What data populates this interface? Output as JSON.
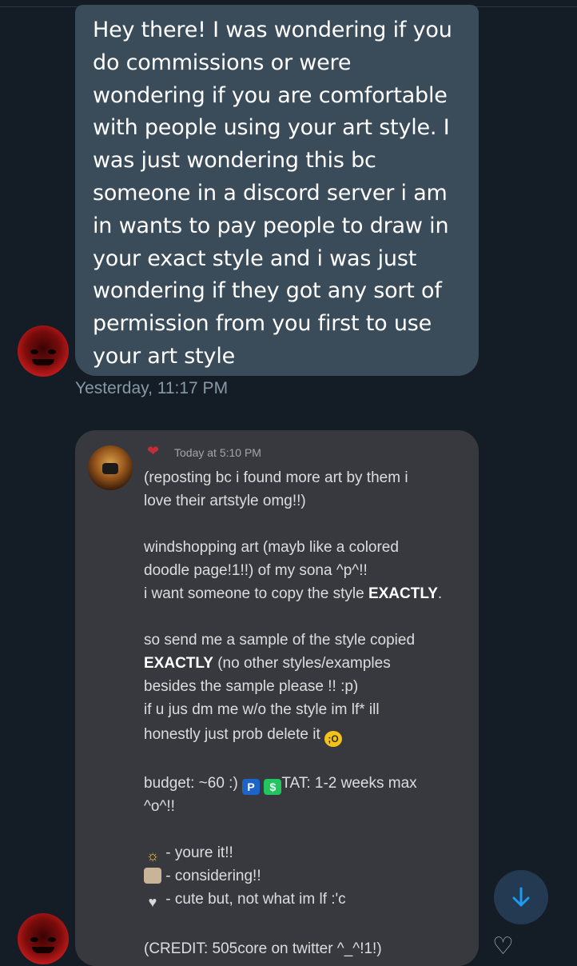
{
  "messages": {
    "received_text": "Hey there! I was wondering if you do commissions or were wondering if you are comfortable with people using your art style. I was just wondering this bc someone in a discord server i am in wants to pay people to draw in your exact style and i was just wondering if they got any sort of permission from you first to use your art style",
    "received_lines": [
      "Hey there! I was wondering if you",
      "do commissions or were",
      "wondering if you are comfortable",
      "with people using your art style. I",
      "was just wondering this bc",
      "someone in a discord server i am",
      "in wants to pay people to draw in",
      "your exact style and i was just",
      "wondering if they got any sort of",
      "permission from you first to use",
      "your art style"
    ],
    "timestamp": "Yesterday, 11:17 PM"
  },
  "attached_post": {
    "time": "Today at 5:10 PM",
    "line1": "(reposting bc i found more art by them i",
    "line2": "love their artstyle omg!!)",
    "line3": "windshopping art (mayb like a colored",
    "line4": "doodle page!1!!) of my sona ^p^!!",
    "line5_pre": "i want someone to copy the style ",
    "line5_bold": "EXACTLY",
    "line5_post": ".",
    "line6": "so send me a sample of the style copied",
    "line7_bold": "EXACTLY",
    "line7_post": " (no other styles/examples",
    "line8": "besides the sample please !! :p)",
    "line9": "if u jus dm me w/o the style im lf* ill",
    "line10": "honestly just prob delete it",
    "line11_pre": "budget: ~60 :) ",
    "line11_post": "TAT: 1-2 weeks max",
    "line12": "^o^!!",
    "legend1": " - youre it!!",
    "legend2": " - considering!!",
    "legend3": " - cute but, not what im lf :'c",
    "credit": "(CREDIT: 505core on twitter ^_^!1!)"
  },
  "icons": {
    "scroll_down": "arrow-down-icon",
    "reaction": "heart-outline-icon",
    "paypal": "P",
    "cashapp": "$"
  },
  "colors": {
    "background": "#141d26",
    "received_bubble": "#3a4b5a",
    "post_bubble": "#37393e",
    "accent": "#1d9bf0"
  }
}
